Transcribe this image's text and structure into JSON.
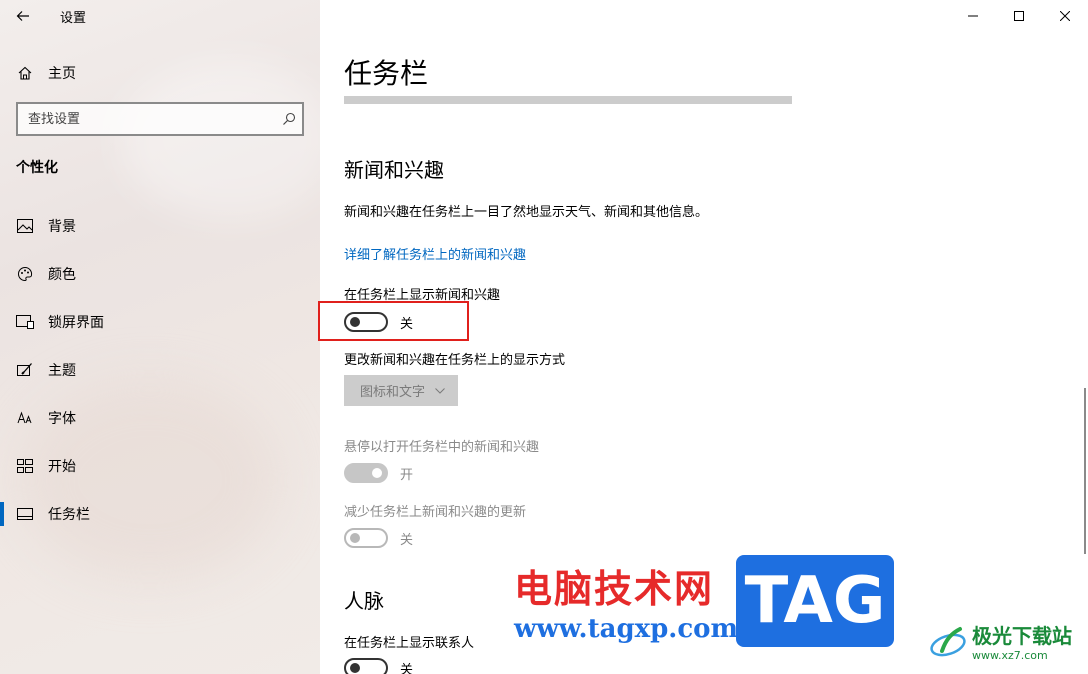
{
  "window": {
    "title": "设置"
  },
  "sidebar": {
    "home_label": "主页",
    "search_placeholder": "查找设置",
    "section_heading": "个性化",
    "items": [
      {
        "label": "背景",
        "icon": "image-icon"
      },
      {
        "label": "颜色",
        "icon": "palette-icon"
      },
      {
        "label": "锁屏界面",
        "icon": "lock-screen-icon"
      },
      {
        "label": "主题",
        "icon": "theme-brush-icon"
      },
      {
        "label": "字体",
        "icon": "font-icon"
      },
      {
        "label": "开始",
        "icon": "start-grid-icon"
      },
      {
        "label": "任务栏",
        "icon": "taskbar-icon",
        "active": true
      }
    ]
  },
  "main": {
    "title": "任务栏",
    "news": {
      "heading": "新闻和兴趣",
      "description": "新闻和兴趣在任务栏上一目了然地显示天气、新闻和其他信息。",
      "link": "详细了解任务栏上的新闻和兴趣",
      "show_label": "在任务栏上显示新闻和兴趣",
      "show_state": "关",
      "display_mode_label": "更改新闻和兴趣在任务栏上的显示方式",
      "display_mode_value": "图标和文字",
      "hover_label": "悬停以打开任务栏中的新闻和兴趣",
      "hover_state": "开",
      "reduce_label": "减少任务栏上新闻和兴趣的更新",
      "reduce_state": "关"
    },
    "people": {
      "heading": "人脉",
      "show_contacts_label": "在任务栏上显示联系人",
      "show_contacts_state": "关"
    }
  },
  "watermark": {
    "cn_text": "电脑技术网",
    "url": "www.tagxp.com",
    "tag": "TAG",
    "site_name": "极光下载站",
    "site_url": "www.xz7.com"
  },
  "colors": {
    "accent": "#0067c0",
    "highlight": "#e0201c",
    "watermark_red": "#e62a2a",
    "watermark_blue": "#1e6fe0"
  }
}
